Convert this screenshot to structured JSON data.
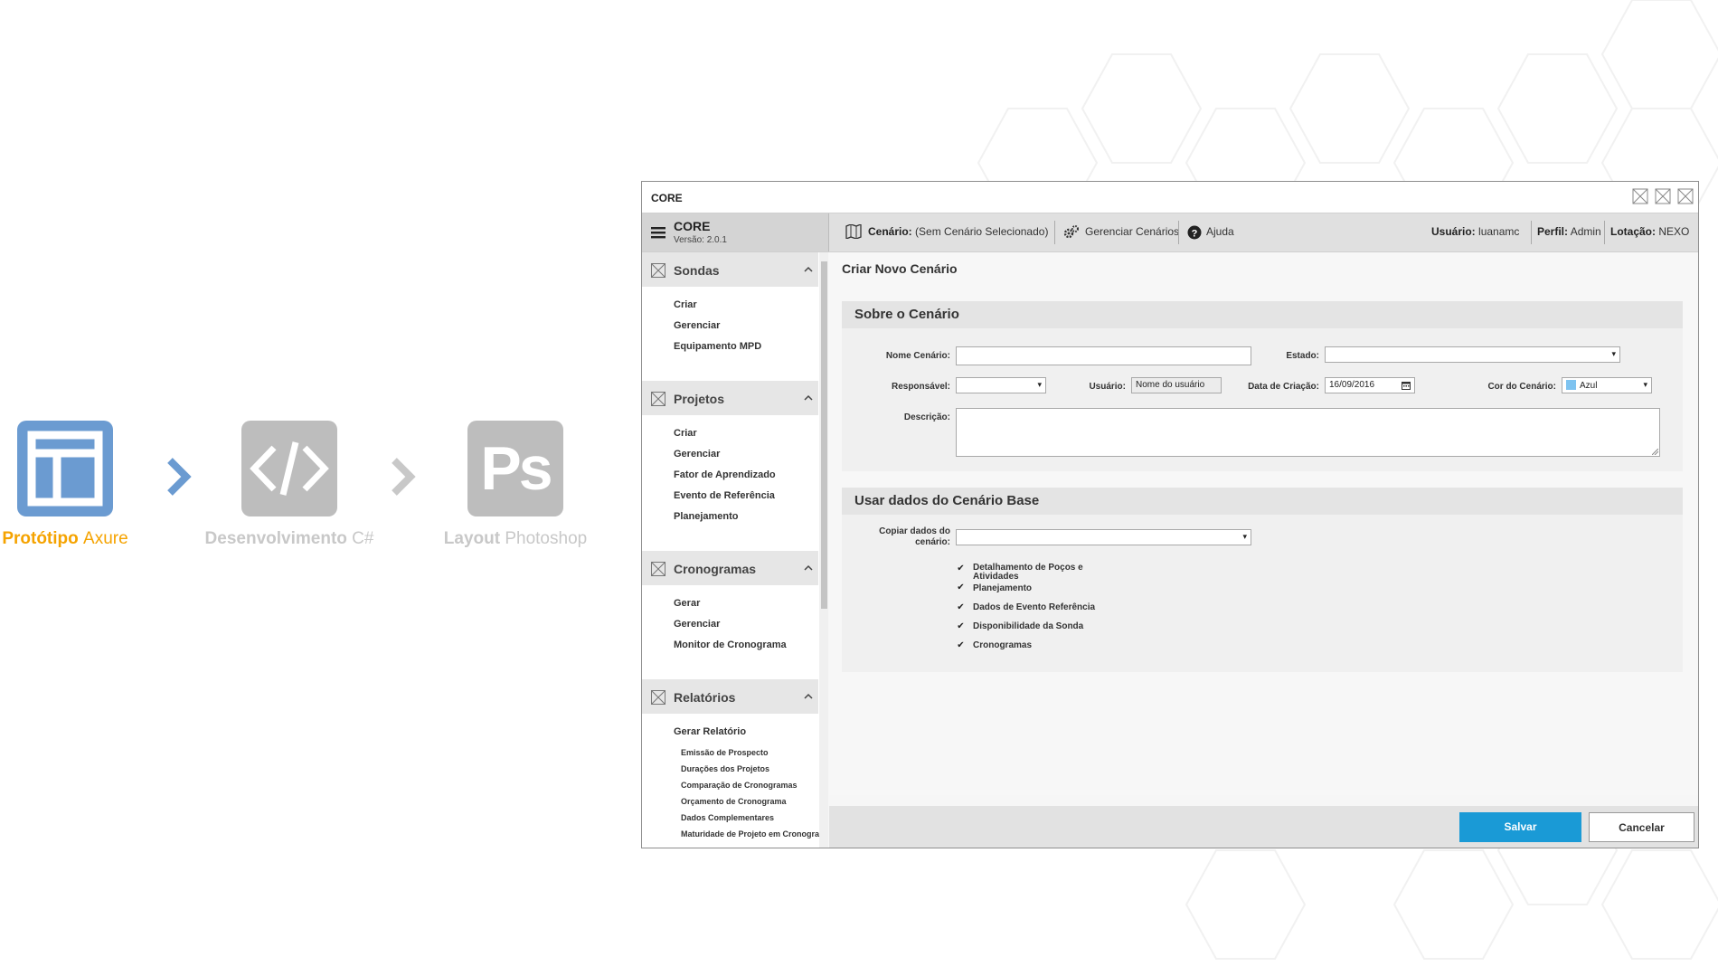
{
  "workflow": {
    "steps": [
      {
        "label_bold": "Protótipo",
        "label_light": "Axure",
        "icon": "layout-icon",
        "color": "#6b9bd1",
        "cap_color": "#f5a300"
      },
      {
        "label_bold": "Desenvolvimento",
        "label_light": "C#",
        "icon": "code-icon",
        "color": "#bdbdbd",
        "cap_color": "#c8c8c8"
      },
      {
        "label_bold": "Layout",
        "label_light": "Photoshop",
        "icon": "photoshop-icon",
        "color": "#bdbdbd",
        "cap_color": "#c8c8c8"
      }
    ],
    "ps_glyph": "Ps"
  },
  "window": {
    "title": "CORE",
    "brand_name": "CORE",
    "brand_version": "Versão: 2.0.1",
    "topbar": {
      "scenario_label": "Cenário:",
      "scenario_value": "(Sem Cenário Selecionado)",
      "manage_label": "Gerenciar Cenários",
      "help_label": "Ajuda",
      "user_label": "Usuário:",
      "user_value": "luanamc",
      "profile_label": "Perfil:",
      "profile_value": "Admin",
      "location_label": "Lotação:",
      "location_value": "NEXO"
    }
  },
  "sidebar": {
    "groups": [
      {
        "title": "Sondas",
        "items": [
          "Criar",
          "Gerenciar",
          "Equipamento MPD"
        ]
      },
      {
        "title": "Projetos",
        "items": [
          "Criar",
          "Gerenciar",
          "Fator de Aprendizado",
          "Evento de Referência",
          "Planejamento"
        ]
      },
      {
        "title": "Cronogramas",
        "items": [
          "Gerar",
          "Gerenciar",
          "Monitor de Cronograma"
        ]
      },
      {
        "title": "Relatórios",
        "items": [
          "Gerar Relatório"
        ],
        "subitems": [
          "Emissão de Prospecto",
          "Durações dos Projetos",
          "Comparação de Cronogramas",
          "Orçamento de Cronograma",
          "Dados Complementares",
          "Maturidade de Projeto em Cronogram"
        ]
      }
    ]
  },
  "form": {
    "page_title": "Criar Novo Cenário",
    "section1": {
      "title": "Sobre o Cenário",
      "name_label": "Nome Cenário:",
      "state_label": "Estado:",
      "responsible_label": "Responsável:",
      "user_label": "Usuário:",
      "user_value": "Nome do usuário",
      "date_label": "Data de Criação:",
      "date_value": "16/09/2016",
      "color_label": "Cor do Cenário:",
      "color_value": "Azul",
      "color_swatch": "#7ec3f0",
      "description_label": "Descrição:"
    },
    "section2": {
      "title": "Usar dados do Cenário Base",
      "copy_label_line1": "Copiar dados do",
      "copy_label_line2": "cenário:",
      "options": [
        "Detalhamento de Poços e Atividades",
        "Planejamento",
        "Dados de Evento Referência",
        "Disponibilidade da Sonda",
        "Cronogramas"
      ]
    },
    "save_label": "Salvar",
    "cancel_label": "Cancelar",
    "accent": "#1a9ad6"
  }
}
